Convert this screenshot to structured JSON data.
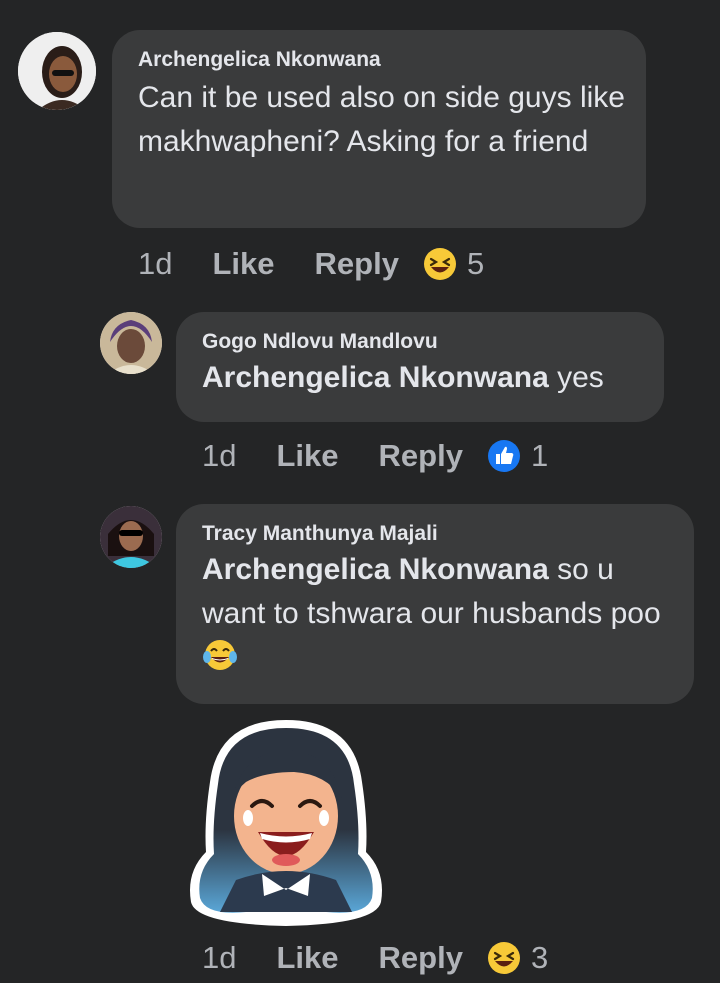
{
  "comments": [
    {
      "author": "Archengelica Nkonwana",
      "text": "Can it be used also on side guys like makhwapheni? Asking for a friend",
      "time": "1d",
      "like_label": "Like",
      "reply_label": "Reply",
      "reaction_icon": "laughing-emoji-icon",
      "reaction_count": "5"
    },
    {
      "author": "Gogo Ndlovu Mandlovu",
      "mention": "Archengelica Nkonwana",
      "text": " yes",
      "time": "1d",
      "like_label": "Like",
      "reply_label": "Reply",
      "reaction_icon": "like-thumb-icon",
      "reaction_count": "1"
    },
    {
      "author": "Tracy Manthunya Majali",
      "mention": "Archengelica Nkonwana",
      "text": " so u want to  tshwara our husbands poo",
      "inline_emoji": "tears-of-joy-emoji-icon",
      "sticker": "laughing-woman-sticker",
      "time": "1d",
      "like_label": "Like",
      "reply_label": "Reply",
      "reaction_icon": "laughing-emoji-icon",
      "reaction_count": "3"
    }
  ],
  "colors": {
    "background": "#242526",
    "bubble": "#3a3b3c",
    "text": "#e4e6eb",
    "secondary": "#b0b3b8",
    "like_blue": "#1877f2",
    "emoji_yellow": "#f7c938"
  }
}
